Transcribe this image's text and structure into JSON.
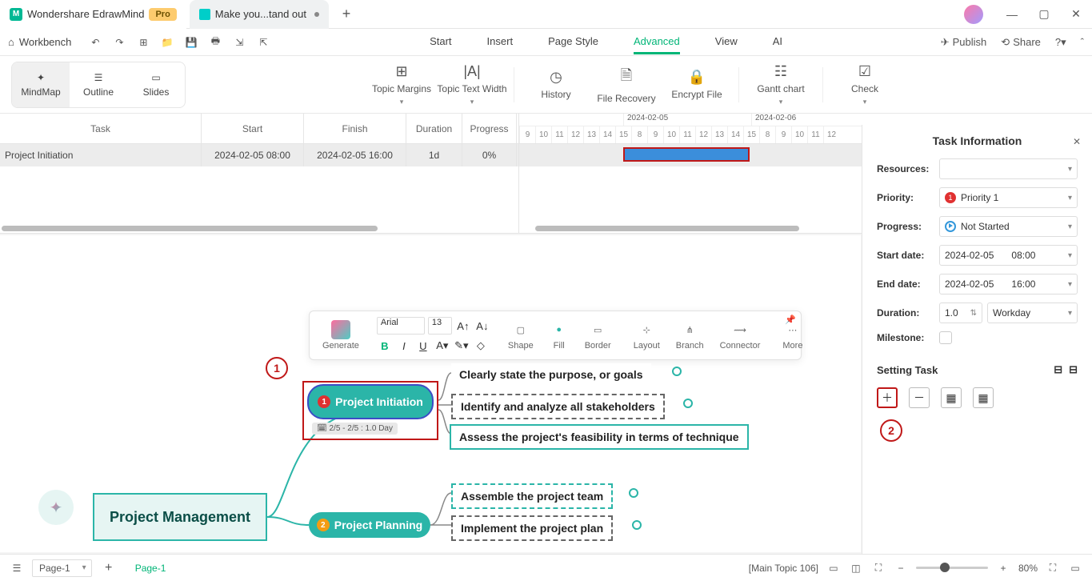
{
  "titlebar": {
    "app_name": "Wondershare EdrawMind",
    "pro": "Pro",
    "doc_tab": "Make you...tand out"
  },
  "toolbar": {
    "workbench": "Workbench",
    "menus": [
      "Start",
      "Insert",
      "Page Style",
      "Advanced",
      "View",
      "AI"
    ],
    "active_menu": "Advanced",
    "publish": "Publish",
    "share": "Share"
  },
  "ribbon": {
    "views": [
      "MindMap",
      "Outline",
      "Slides"
    ],
    "active_view": "MindMap",
    "buttons": [
      "Topic Margins",
      "Topic Text Width",
      "History",
      "File Recovery",
      "Encrypt File",
      "Gantt chart",
      "Check"
    ]
  },
  "gantt": {
    "headers": [
      "Task",
      "Start",
      "Finish",
      "Duration",
      "Progress"
    ],
    "row": {
      "task": "Project Initiation",
      "start": "2024-02-05 08:00",
      "finish": "2024-02-05 16:00",
      "duration": "1d",
      "progress": "0%"
    },
    "dates": [
      "2024-02-05",
      "2024-02-06"
    ],
    "hours": [
      "9",
      "10",
      "11",
      "12",
      "13",
      "14",
      "15",
      "8",
      "9",
      "10",
      "11",
      "12",
      "13",
      "14",
      "15",
      "8",
      "9",
      "10",
      "11",
      "12"
    ]
  },
  "float_toolbar": {
    "generate": "Generate",
    "font": "Arial",
    "size": "13",
    "shape": "Shape",
    "fill": "Fill",
    "border": "Border",
    "layout": "Layout",
    "branch": "Branch",
    "connector": "Connector",
    "more": "More"
  },
  "mindmap": {
    "root": "Project Management",
    "topic1": "Project Initiation",
    "topic1_date": "2/5 - 2/5 : 1.0 Day",
    "topic2": "Project Planning",
    "sub1": "Clearly state the purpose, or goals",
    "sub2": "Identify and analyze all stakeholders",
    "sub3": "Assess the project's feasibility in terms of technique",
    "sub4": "Assemble the project team",
    "sub5": "Implement the project plan",
    "anno1": "1",
    "anno2": "2"
  },
  "task_panel": {
    "title": "Task Information",
    "resources_lbl": "Resources:",
    "priority_lbl": "Priority:",
    "priority_val": "Priority 1",
    "progress_lbl": "Progress:",
    "progress_val": "Not Started",
    "start_lbl": "Start date:",
    "start_date": "2024-02-05",
    "start_time": "08:00",
    "end_lbl": "End date:",
    "end_date": "2024-02-05",
    "end_time": "16:00",
    "duration_lbl": "Duration:",
    "duration_val": "1.0",
    "duration_unit": "Workday",
    "milestone_lbl": "Milestone:",
    "setting_task": "Setting Task"
  },
  "statusbar": {
    "page_sel": "Page-1",
    "page_tab": "Page-1",
    "context": "[Main Topic 106]",
    "zoom": "80%"
  }
}
